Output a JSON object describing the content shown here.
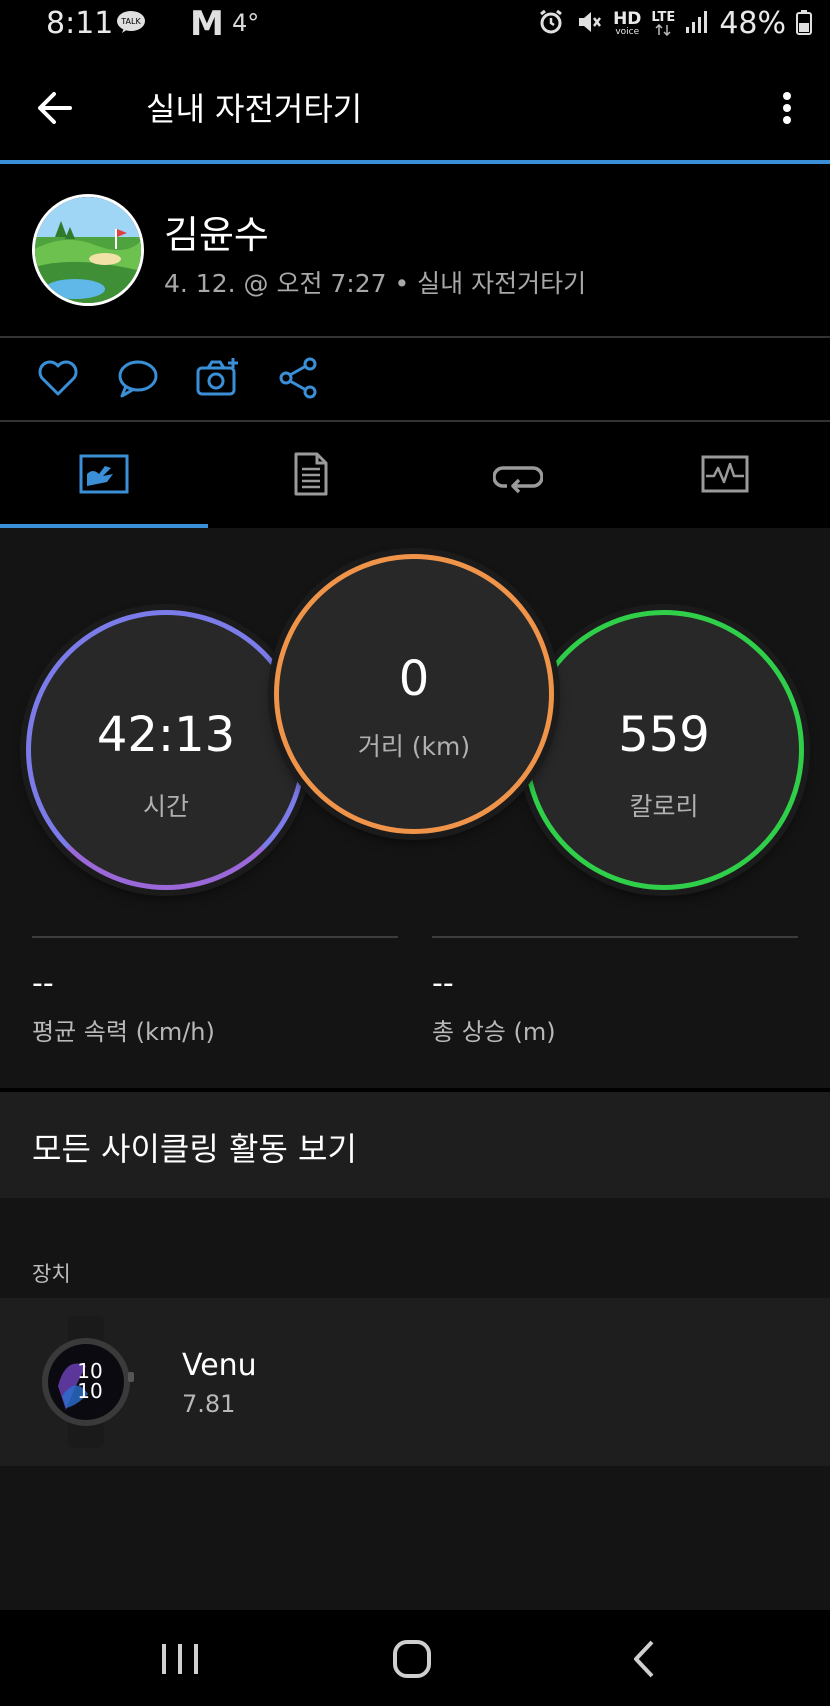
{
  "status_bar": {
    "time": "8:11",
    "talk_badge": "TALK",
    "gmail_letter": "M",
    "temperature": "4°",
    "hd_label": "HD",
    "voice_label": "voice",
    "lte_label": "LTE",
    "battery": "48%",
    "icons": [
      "alarm-icon",
      "mute-icon",
      "signal-icon",
      "battery-icon"
    ]
  },
  "app_bar": {
    "title": "실내 자전거타기",
    "back_icon": "arrow-left-icon",
    "more_icon": "more-vertical-icon"
  },
  "profile": {
    "name": "김윤수",
    "meta": "4. 12. @ 오전 7:27 • 실내 자전거타기",
    "avatar_icon": "golf-course-avatar"
  },
  "actions": [
    {
      "name": "like",
      "icon": "heart-icon"
    },
    {
      "name": "comment",
      "icon": "comment-icon"
    },
    {
      "name": "add-photo",
      "icon": "camera-plus-icon"
    },
    {
      "name": "share",
      "icon": "share-icon"
    }
  ],
  "tabs": [
    {
      "name": "overview",
      "icon": "overview-icon",
      "selected": true
    },
    {
      "name": "details",
      "icon": "document-icon",
      "selected": false
    },
    {
      "name": "laps",
      "icon": "laps-icon",
      "selected": false
    },
    {
      "name": "charts",
      "icon": "chart-icon",
      "selected": false
    }
  ],
  "summary": {
    "time": {
      "value": "42:13",
      "label": "시간",
      "color": "#7b7bea"
    },
    "distance": {
      "value": "0",
      "label": "거리 (km)",
      "color": "#f0944a"
    },
    "calories": {
      "value": "559",
      "label": "칼로리",
      "color": "#2fcf4a"
    },
    "avg_speed": {
      "value": "--",
      "label": "평균 속력 (km/h)"
    },
    "total_ascent": {
      "value": "--",
      "label": "총 상승 (m)"
    }
  },
  "all_cycling_link": "모든 사이클링 활동 보기",
  "devices": {
    "heading": "장치",
    "items": [
      {
        "name": "Venu",
        "version": "7.81",
        "face_time_top": "10",
        "face_time_bottom": "10"
      }
    ]
  },
  "nav_bar": {
    "recent_icon": "recent-apps-icon",
    "home_icon": "home-icon",
    "back_icon": "back-chevron-icon"
  },
  "colors": {
    "accent": "#3a8fd7",
    "background": "#000000",
    "panel": "#141414"
  }
}
